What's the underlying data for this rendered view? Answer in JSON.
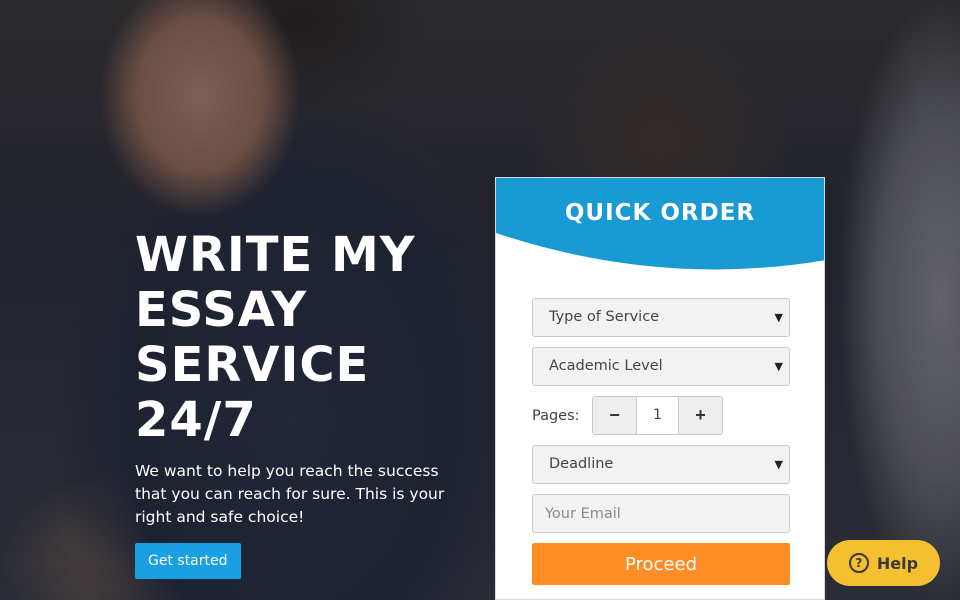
{
  "hero": {
    "title": "WRITE MY ESSAY SERVICE 24/7",
    "subtitle": "We want to help you reach the success that you can reach for sure. This is your right and safe choice!",
    "cta_label": "Get started"
  },
  "order": {
    "title": "QUICK ORDER",
    "service_select": "Type of Service",
    "level_select": "Academic Level",
    "pages_label": "Pages:",
    "pages_value": "1",
    "minus_label": "−",
    "plus_label": "+",
    "deadline_select": "Deadline",
    "email_placeholder": "Your Email",
    "proceed_label": "Proceed"
  },
  "help": {
    "label": "Help",
    "icon": "question-circle"
  },
  "colors": {
    "header_blue": "#1a9ad3",
    "cta_blue": "#1a9fe0",
    "proceed_orange": "#ff8c25",
    "help_yellow": "#f5c02f"
  }
}
